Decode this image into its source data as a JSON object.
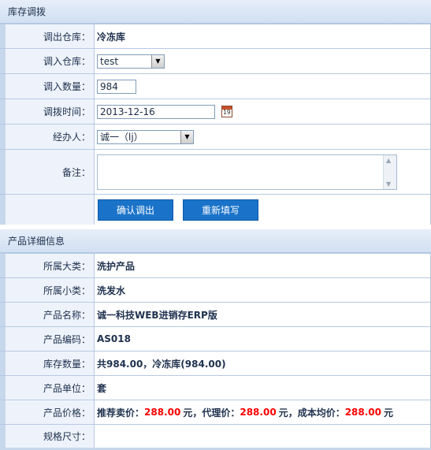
{
  "transfer": {
    "title": "库存调拨",
    "from_label": "调出仓库：",
    "from_value": "冷冻库",
    "to_label": "调入仓库：",
    "to_value": "test",
    "qty_label": "调入数量：",
    "qty_value": "984",
    "time_label": "调拨时间：",
    "time_value": "2013-12-16",
    "handler_label": "经办人：",
    "handler_value": "诚一（lj）",
    "note_label": "备注：",
    "note_value": "",
    "confirm_button": "确认调出",
    "reset_button": "重新填写",
    "calendar_day": "19"
  },
  "product": {
    "title": "产品详细信息",
    "category_label": "所属大类：",
    "category_value": "洗护产品",
    "subcategory_label": "所属小类：",
    "subcategory_value": "洗发水",
    "name_label": "产品名称：",
    "name_value": "诚一科技WEB进销存ERP版",
    "code_label": "产品编码：",
    "code_value": "AS018",
    "stock_label": "库存数量：",
    "stock_value": "共984.00，冷冻库(984.00)",
    "unit_label": "产品单位：",
    "unit_value": "套",
    "price_label": "产品价格：",
    "price_retail_label": "推荐卖价：",
    "price_retail_value": "288.00",
    "price_agent_label": "，代理价：",
    "price_agent_value": "288.00",
    "price_cost_label": "，成本均价：",
    "price_cost_value": "288.00",
    "currency": "元",
    "spec_label": "规格尺寸：",
    "spec_value": ""
  },
  "colors": {
    "accent": "#1a73c9",
    "price": "#ff0000",
    "frame": "#c7d7ec"
  }
}
